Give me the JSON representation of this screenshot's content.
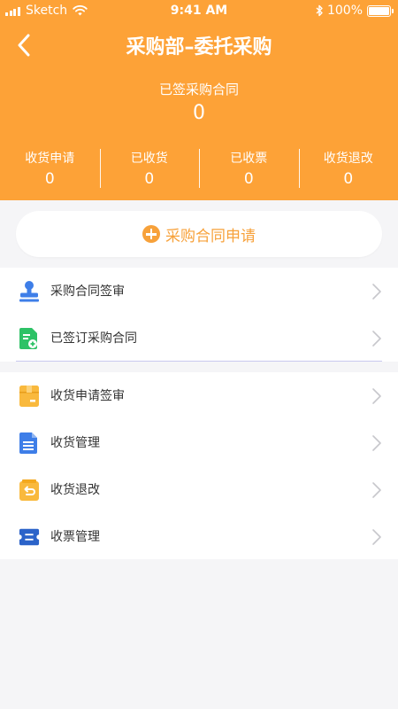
{
  "status_bar": {
    "carrier": "Sketch",
    "time": "9:41 AM",
    "battery_percent": "100%",
    "battery_level": 1.0
  },
  "nav": {
    "title": "采购部–委托采购",
    "back_icon": "chevron-left-icon"
  },
  "summary": {
    "label": "已签采购合同",
    "value": "0"
  },
  "stats": [
    {
      "label": "收货申请",
      "value": "0"
    },
    {
      "label": "已收货",
      "value": "0"
    },
    {
      "label": "已收票",
      "value": "0"
    },
    {
      "label": "收货退改",
      "value": "0"
    }
  ],
  "apply_button": {
    "label": "采购合同申请",
    "icon": "plus-circle-icon"
  },
  "menu_group_1": [
    {
      "label": "采购合同签审",
      "icon": "stamp-icon"
    },
    {
      "label": "已签订采购合同",
      "icon": "signed-contract-icon"
    }
  ],
  "menu_group_2": [
    {
      "label": "收货申请签审",
      "icon": "package-icon"
    },
    {
      "label": "收货管理",
      "icon": "document-list-icon"
    },
    {
      "label": "收货退改",
      "icon": "return-package-icon"
    },
    {
      "label": "收票管理",
      "icon": "ticket-icon"
    }
  ],
  "colors": {
    "header": "#fda237",
    "accent": "#f7a13a",
    "blue": "#3e7ee8",
    "green": "#2dc266",
    "yellow": "#f9b93d",
    "background": "#f5f5f7"
  }
}
